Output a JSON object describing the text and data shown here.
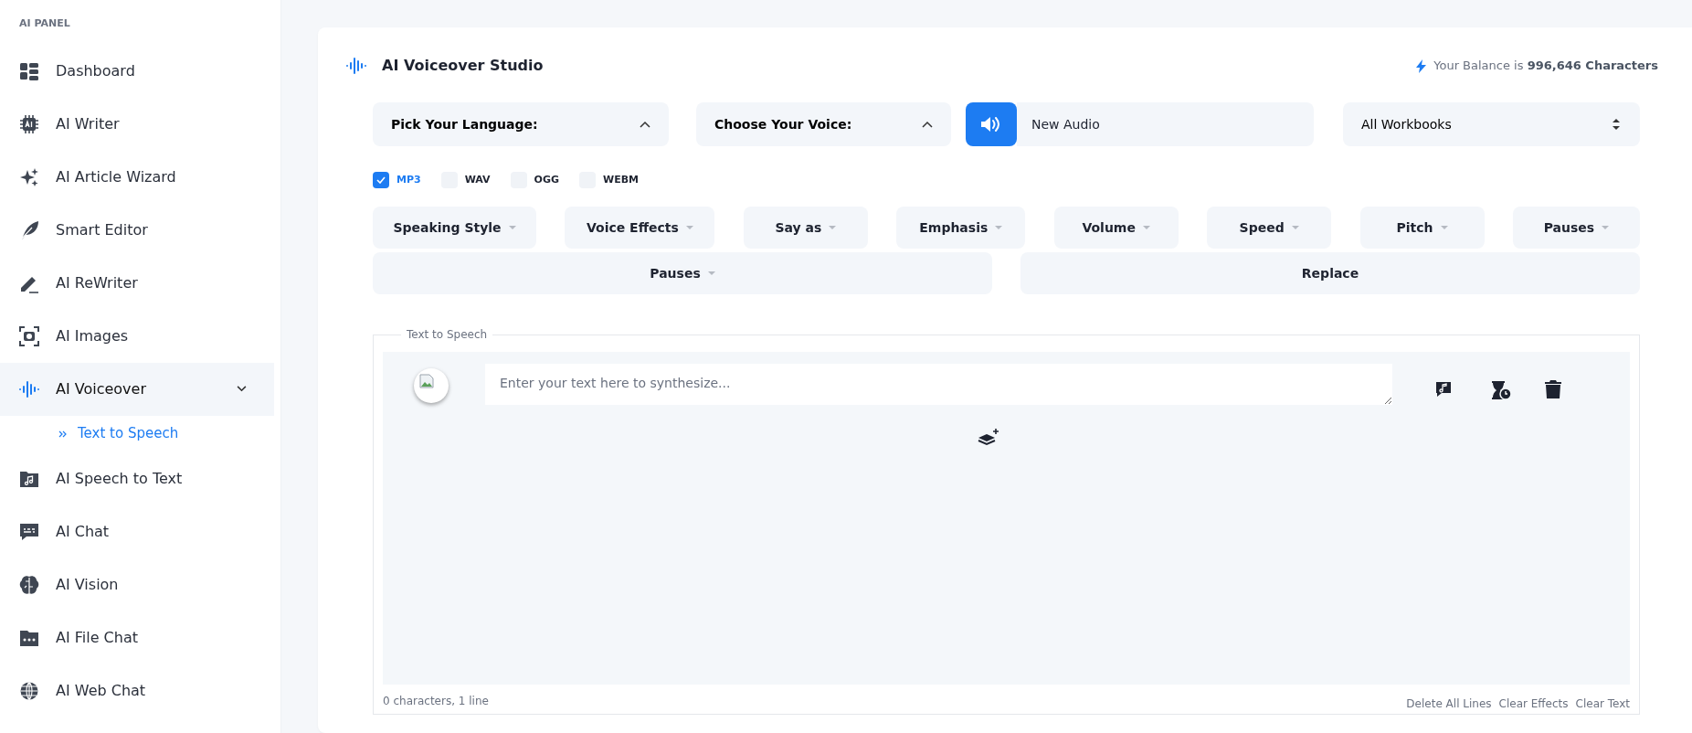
{
  "sidebar": {
    "heading": "AI PANEL",
    "items": [
      {
        "label": "Dashboard",
        "selected": false
      },
      {
        "label": "AI Writer",
        "selected": false
      },
      {
        "label": "AI Article Wizard",
        "selected": false
      },
      {
        "label": "Smart Editor",
        "selected": false
      },
      {
        "label": "AI ReWriter",
        "selected": false
      },
      {
        "label": "AI Images",
        "selected": false
      },
      {
        "label": "AI Voiceover",
        "selected": true,
        "expanded": true,
        "children": [
          {
            "label": "Text to Speech",
            "selected": true
          }
        ]
      },
      {
        "label": "AI Speech to Text",
        "selected": false
      },
      {
        "label": "AI Chat",
        "selected": false
      },
      {
        "label": "AI Vision",
        "selected": false
      },
      {
        "label": "AI File Chat",
        "selected": false
      },
      {
        "label": "AI Web Chat",
        "selected": false
      }
    ]
  },
  "studio": {
    "title": "AI Voiceover Studio",
    "balance": "Your Balance is **996,646 Characters**",
    "language_select": {
      "label": "Pick Your Language:",
      "expanded": true
    },
    "voice_select": {
      "label": "Choose Your Voice:",
      "expanded": true
    },
    "audio_name": {
      "value": "New Audio"
    },
    "workbook_select": {
      "value": "All Workbooks"
    },
    "formats": [
      {
        "label": "MP3",
        "checked": true
      },
      {
        "label": "WAV",
        "checked": false
      },
      {
        "label": "OGG",
        "checked": false
      },
      {
        "label": "WEBM",
        "checked": false
      }
    ],
    "effects": [
      {
        "label": "Speaking Style",
        "kind": "dropdown"
      },
      {
        "label": "Voice Effects",
        "kind": "dropdown"
      },
      {
        "label": "Say as",
        "kind": "dropdown"
      },
      {
        "label": "Emphasis",
        "kind": "dropdown"
      },
      {
        "label": "Volume",
        "kind": "dropdown"
      },
      {
        "label": "Speed",
        "kind": "dropdown"
      },
      {
        "label": "Pitch",
        "kind": "dropdown"
      },
      {
        "label": "Pauses",
        "kind": "dropdown"
      }
    ],
    "effects_row_2": [
      {
        "label": "Pauses",
        "kind": "dropdown"
      },
      {
        "label": "Replace",
        "kind": "button"
      }
    ],
    "editor": {
      "legend": "Text to Speech",
      "placeholder": "Enter your text here to synthesize...",
      "status": "0 characters, 1 line",
      "actions": [
        "Delete All Lines",
        "Clear Effects",
        "Clear Text"
      ]
    }
  }
}
